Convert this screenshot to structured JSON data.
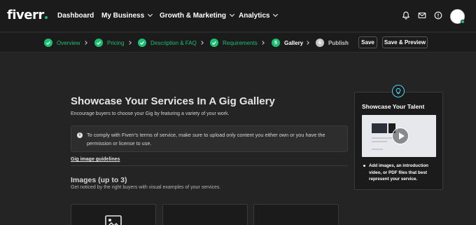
{
  "brand": {
    "logo_text": "fiverr",
    "accent": "#1dbf73"
  },
  "nav": {
    "items": [
      {
        "label": "Dashboard",
        "has_dropdown": false
      },
      {
        "label": "My Business",
        "has_dropdown": true
      },
      {
        "label": "Growth & Marketing",
        "has_dropdown": true
      },
      {
        "label": "Analytics",
        "has_dropdown": true
      }
    ],
    "icons": [
      "bell-icon",
      "envelope-icon",
      "help-icon"
    ]
  },
  "steps": [
    {
      "label": "Overview",
      "status": "done"
    },
    {
      "label": "Pricing",
      "status": "done"
    },
    {
      "label": "Description & FAQ",
      "status": "done"
    },
    {
      "label": "Requirements",
      "status": "done"
    },
    {
      "number": "5",
      "label": "Gallery",
      "status": "active"
    },
    {
      "number": "6",
      "label": "Publish",
      "status": "todo"
    }
  ],
  "actions": {
    "save_label": "Save",
    "save_preview_label": "Save & Preview"
  },
  "main": {
    "title": "Showcase Your Services In A Gig Gallery",
    "subtitle": "Encourage buyers to choose your Gig by featuring a variety of your work.",
    "notice_icon": "i",
    "notice": "To comply with Fiverr's terms of service, make sure to upload only content you either own or you have the permission or license to use.",
    "guidelines_link": "Gig image guidelines",
    "images_title": "Images (up to 3)",
    "images_subtitle": "Get noticed by the right buyers with visual examples of your services."
  },
  "tip": {
    "title": "Showcase Your Talent",
    "bullet": "Add images, an introduction video, or PDF files that best represent your service."
  }
}
